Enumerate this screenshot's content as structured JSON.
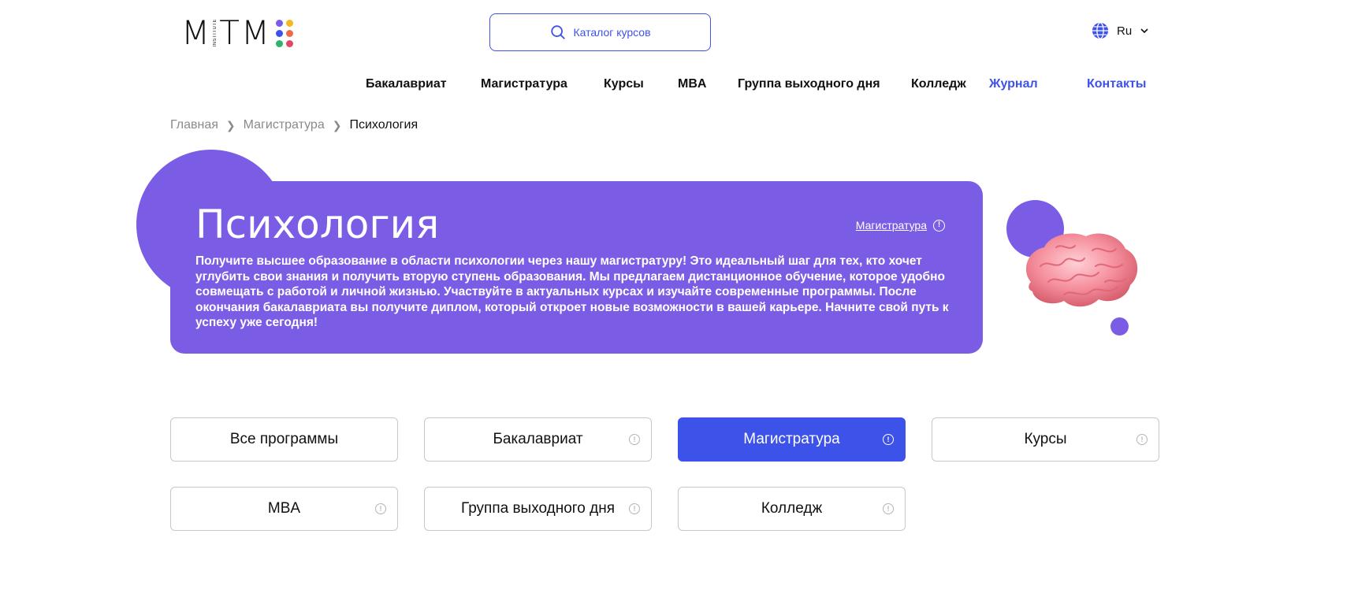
{
  "logo": {
    "text": "MITM",
    "sub": "INSTITUTE"
  },
  "search": {
    "label": "Каталог курсов"
  },
  "lang": {
    "label": "Ru"
  },
  "nav": {
    "items": [
      "Бакалавриат",
      "Магистратура",
      "Курсы",
      "MBA",
      "Группа выходного дня",
      "Колледж",
      "Журнал",
      "Контакты"
    ]
  },
  "breadcrumb": {
    "home": "Главная",
    "parent": "Магистратура",
    "current": "Психология"
  },
  "hero": {
    "title": "Психология",
    "link": "Магистратура",
    "description": "Получите высшее образование в области психологии через нашу магистратуру! Это идеальный шаг для тех, кто хочет углубить свои знания и получить вторую ступень образования. Мы предлагаем дистанционное обучение, которое удобно совмещать с работой и личной жизнью. Участвуйте в актуальных курсах и изучайте современные программы. После окончания бакалавриата вы получите диплом, который откроет новые возможности в вашей карьере. Начните свой путь к успеху уже сегодня!"
  },
  "filters": {
    "items": [
      "Все программы",
      "Бакалавриат",
      "Магистратура",
      "Курсы",
      "MBA",
      "Группа выходного дня",
      "Колледж"
    ],
    "active": "Магистратура"
  },
  "colors": {
    "accent": "#3d52e8",
    "hero": "#7b5ce5",
    "logo_dots": [
      "#7b5ce5",
      "#f5b820",
      "#3d52e8",
      "#f06a4a",
      "#2fb36a",
      "#e0486a"
    ]
  },
  "icons": [
    "search-icon",
    "globe-icon",
    "chevron-down-icon",
    "chevron-right-icon",
    "info-icon",
    "brain-image"
  ]
}
